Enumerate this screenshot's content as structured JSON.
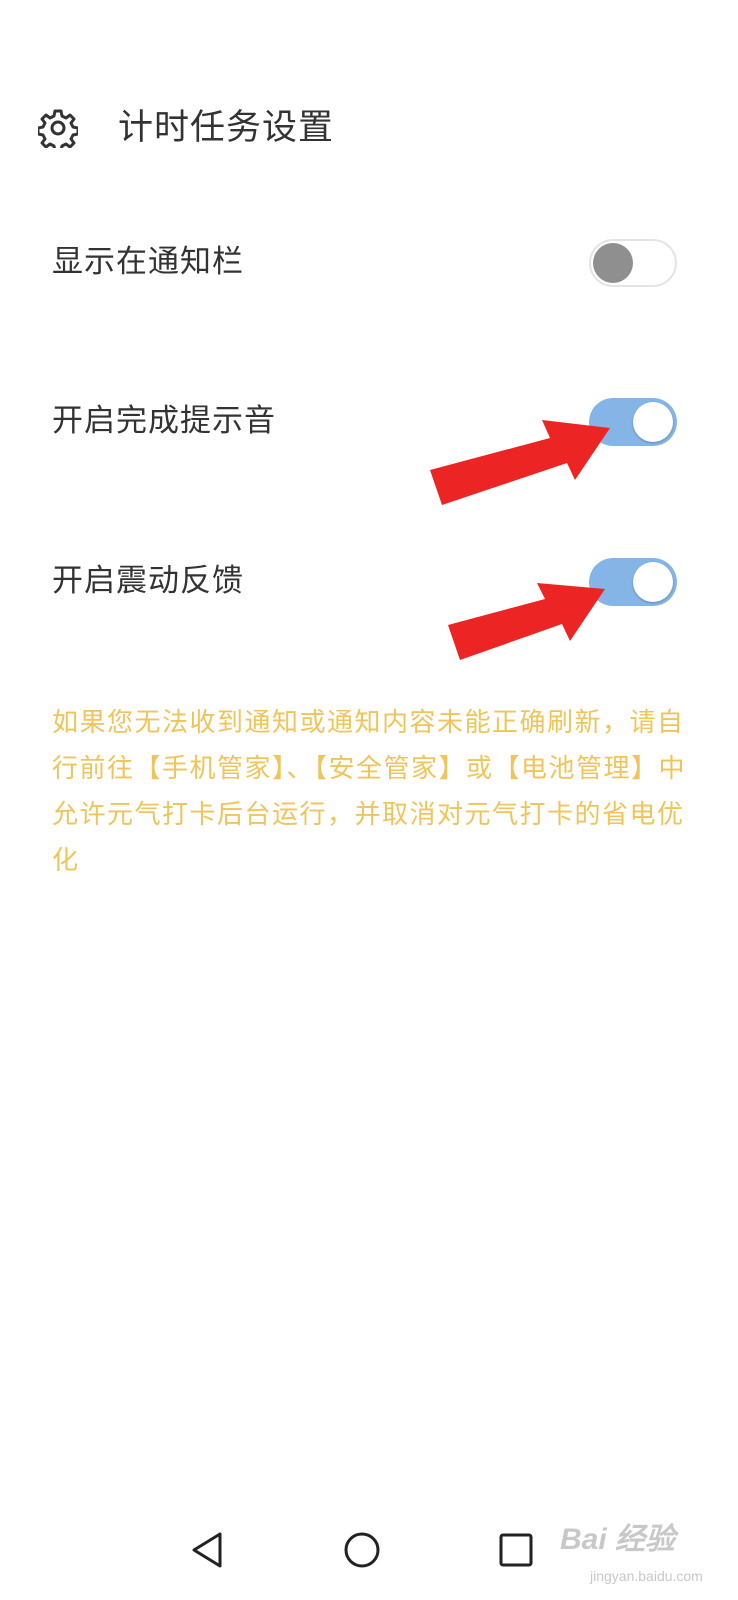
{
  "header": {
    "icon": "gear-icon",
    "title": "计时任务设置"
  },
  "settings": [
    {
      "label": "显示在通知栏",
      "enabled": false
    },
    {
      "label": "开启完成提示音",
      "enabled": true
    },
    {
      "label": "开启震动反馈",
      "enabled": true
    }
  ],
  "notice": "如果您无法收到通知或通知内容未能正确刷新，请自行前往【手机管家】、【安全管家】或【电池管理】中允许元气打卡后台运行，并取消对元气打卡的省电优化",
  "colors": {
    "switch_on": "#85b4e6",
    "switch_off_thumb": "#8f8f8f",
    "notice_text": "#f0c45a",
    "annotation_arrow": "#ec2424"
  },
  "navbar": {
    "back_icon": "triangle-back-icon",
    "home_icon": "circle-home-icon",
    "recents_icon": "square-recents-icon"
  },
  "watermark": {
    "brand": "Bai 经验",
    "url": "jingyan.baidu.com"
  }
}
